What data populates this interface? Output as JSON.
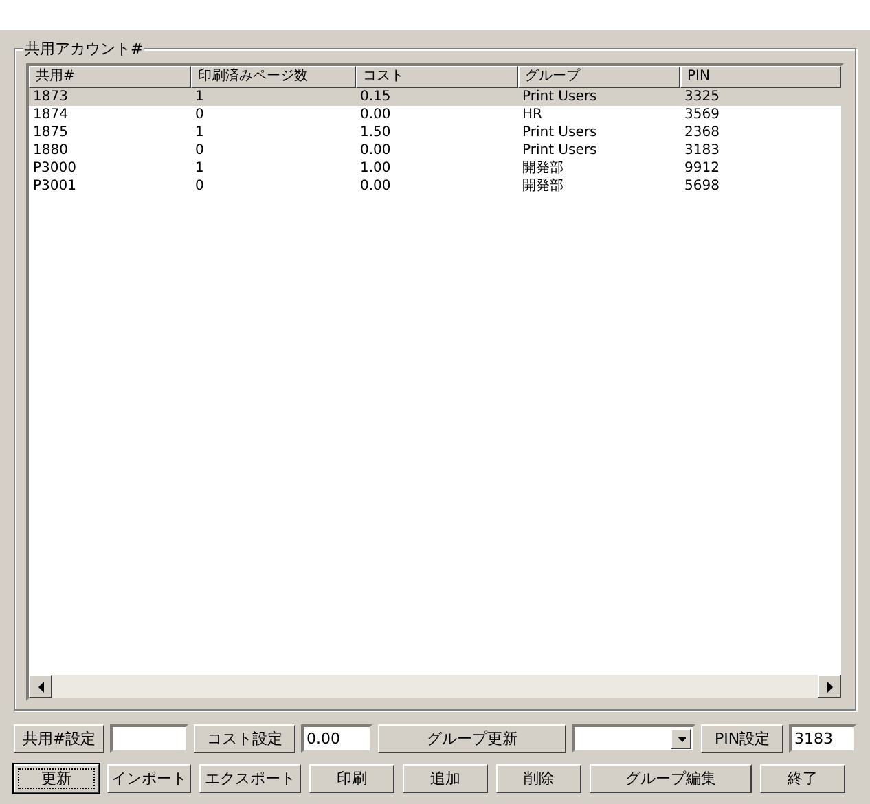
{
  "group": {
    "title": "共用アカウント#"
  },
  "table": {
    "columns": [
      "共用#",
      "印刷済みページ数",
      "コスト",
      "グループ",
      "PIN"
    ],
    "rows": [
      {
        "cells": [
          "1873",
          "1",
          "0.15",
          "Print Users",
          "3325"
        ],
        "selected": true
      },
      {
        "cells": [
          "1874",
          "0",
          "0.00",
          "HR",
          "3569"
        ],
        "selected": false
      },
      {
        "cells": [
          "1875",
          "1",
          "1.50",
          "Print Users",
          "2368"
        ],
        "selected": false
      },
      {
        "cells": [
          "1880",
          "0",
          "0.00",
          "Print Users",
          "3183"
        ],
        "selected": false
      },
      {
        "cells": [
          "P3000",
          "1",
          "1.00",
          "開発部",
          "9912"
        ],
        "selected": false
      },
      {
        "cells": [
          "P3001",
          "0",
          "0.00",
          "開発部",
          "5698"
        ],
        "selected": false
      }
    ]
  },
  "settings": [
    {
      "kind": "field",
      "button": "共用#設定"
    },
    {
      "kind": "field",
      "button": "コスト設定",
      "value": "0.00"
    },
    {
      "kind": "combo",
      "button": "グループ更新"
    },
    {
      "kind": "field",
      "button": "PIN設定",
      "value": "3183"
    }
  ],
  "actions": [
    {
      "label": "更新",
      "focused": true
    },
    {
      "label": "インポート",
      "focused": false
    },
    {
      "label": "エクスポート",
      "focused": false
    },
    {
      "label": "印刷",
      "focused": false
    },
    {
      "label": "追加",
      "focused": false
    },
    {
      "label": "削除",
      "focused": false
    },
    {
      "label": "グループ編集",
      "focused": false
    },
    {
      "label": "終了",
      "focused": false
    }
  ]
}
